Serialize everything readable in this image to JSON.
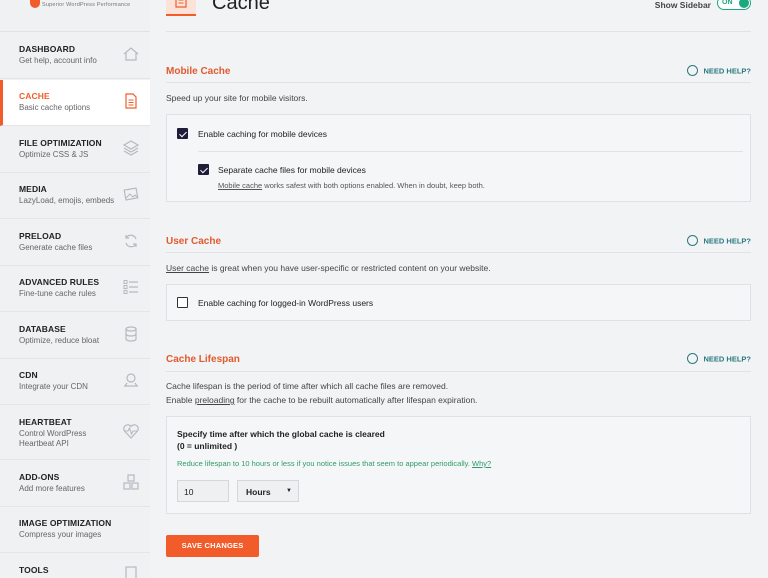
{
  "brand": {
    "tagline": "Superior WordPress Performance",
    "accent": "#f25c2a"
  },
  "sidebar": {
    "items": [
      {
        "title": "DASHBOARD",
        "sub": "Get help, account info",
        "icon": "home-icon"
      },
      {
        "title": "CACHE",
        "sub": "Basic cache options",
        "icon": "document-icon"
      },
      {
        "title": "FILE OPTIMIZATION",
        "sub": "Optimize CSS & JS",
        "icon": "layers-icon"
      },
      {
        "title": "MEDIA",
        "sub": "LazyLoad, emojis, embeds",
        "icon": "image-icon"
      },
      {
        "title": "PRELOAD",
        "sub": "Generate cache files",
        "icon": "refresh-icon"
      },
      {
        "title": "ADVANCED RULES",
        "sub": "Fine-tune cache rules",
        "icon": "list-icon"
      },
      {
        "title": "DATABASE",
        "sub": "Optimize, reduce bloat",
        "icon": "database-icon"
      },
      {
        "title": "CDN",
        "sub": "Integrate your CDN",
        "icon": "cdn-icon"
      },
      {
        "title": "HEARTBEAT",
        "sub": "Control WordPress Heartbeat API",
        "icon": "heartbeat-icon"
      },
      {
        "title": "ADD-ONS",
        "sub": "Add more features",
        "icon": "addons-icon"
      },
      {
        "title": "IMAGE OPTIMIZATION",
        "sub": "Compress your images",
        "icon": ""
      },
      {
        "title": "TOOLS",
        "sub": "",
        "icon": "tools-icon"
      }
    ]
  },
  "header": {
    "title": "Cache",
    "show_sidebar": "Show Sidebar",
    "toggle_label": "ON"
  },
  "mobile": {
    "title": "Mobile Cache",
    "help": "NEED HELP?",
    "desc": "Speed up your site for mobile visitors.",
    "enable_label": "Enable caching for mobile devices",
    "separate_label": "Separate cache files for mobile devices",
    "note_link": "Mobile cache",
    "note_rest": " works safest with both options enabled. When in doubt, keep both."
  },
  "user": {
    "title": "User Cache",
    "help": "NEED HELP?",
    "desc_link": "User cache",
    "desc_rest": " is great when you have user-specific or restricted content on your website.",
    "enable_label": "Enable caching for logged-in WordPress users"
  },
  "lifespan": {
    "title": "Cache Lifespan",
    "help": "NEED HELP?",
    "desc1": "Cache lifespan is the period of time after which all cache files are removed.",
    "desc2_pre": "Enable ",
    "desc2_link": "preloading",
    "desc2_post": " for the cache to be rebuilt automatically after lifespan expiration.",
    "field_label1": "Specify time after which the global cache is cleared",
    "field_label2": "(0 = unlimited )",
    "green_note": "Reduce lifespan to 10 hours or less if you notice issues that seem to appear periodically. ",
    "green_link": "Why?",
    "value": "10",
    "unit": "Hours"
  },
  "save_label": "SAVE CHANGES"
}
